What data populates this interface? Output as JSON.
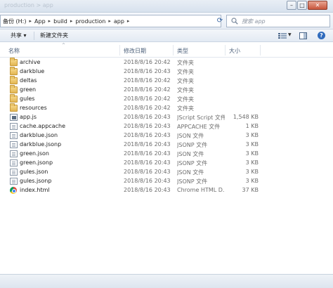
{
  "window": {
    "title": "production > app",
    "controls": {
      "minimize": "–",
      "maximize": "□",
      "close": "✕"
    }
  },
  "address": {
    "back_glyph": "◄",
    "crumbs": [
      "备份 (H:)",
      "App",
      "build",
      "production",
      "app"
    ],
    "separator": "▸",
    "refresh_glyph": "⟳",
    "search_placeholder": "搜索 app"
  },
  "commandbar": {
    "share_label": "共享 ▾",
    "new_folder_label": "新建文件夹",
    "help_glyph": "?"
  },
  "columns": {
    "name": "名称",
    "date": "修改日期",
    "type": "类型",
    "size": "大小",
    "sort_glyph": "^"
  },
  "files": [
    {
      "name": "archive",
      "date": "2018/8/16 20:42",
      "type": "文件夹",
      "size": "",
      "icon": "folder"
    },
    {
      "name": "darkblue",
      "date": "2018/8/16 20:43",
      "type": "文件夹",
      "size": "",
      "icon": "folder"
    },
    {
      "name": "deltas",
      "date": "2018/8/16 20:42",
      "type": "文件夹",
      "size": "",
      "icon": "folder"
    },
    {
      "name": "green",
      "date": "2018/8/16 20:42",
      "type": "文件夹",
      "size": "",
      "icon": "folder"
    },
    {
      "name": "gules",
      "date": "2018/8/16 20:42",
      "type": "文件夹",
      "size": "",
      "icon": "folder"
    },
    {
      "name": "resources",
      "date": "2018/8/16 20:42",
      "type": "文件夹",
      "size": "",
      "icon": "folder"
    },
    {
      "name": "app.js",
      "date": "2018/8/16 20:43",
      "type": "JScript Script 文件",
      "size": "1,548 KB",
      "icon": "js"
    },
    {
      "name": "cache.appcache",
      "date": "2018/8/16 20:43",
      "type": "APPCACHE 文件",
      "size": "1 KB",
      "icon": "doc"
    },
    {
      "name": "darkblue.json",
      "date": "2018/8/16 20:43",
      "type": "JSON 文件",
      "size": "3 KB",
      "icon": "doc"
    },
    {
      "name": "darkblue.jsonp",
      "date": "2018/8/16 20:43",
      "type": "JSONP 文件",
      "size": "3 KB",
      "icon": "doc"
    },
    {
      "name": "green.json",
      "date": "2018/8/16 20:43",
      "type": "JSON 文件",
      "size": "3 KB",
      "icon": "doc"
    },
    {
      "name": "green.jsonp",
      "date": "2018/8/16 20:43",
      "type": "JSONP 文件",
      "size": "3 KB",
      "icon": "doc"
    },
    {
      "name": "gules.json",
      "date": "2018/8/16 20:43",
      "type": "JSON 文件",
      "size": "3 KB",
      "icon": "doc"
    },
    {
      "name": "gules.jsonp",
      "date": "2018/8/16 20:43",
      "type": "JSONP 文件",
      "size": "3 KB",
      "icon": "doc"
    },
    {
      "name": "index.html",
      "date": "2018/8/16 20:43",
      "type": "Chrome HTML D...",
      "size": "37 KB",
      "icon": "chrome"
    }
  ]
}
